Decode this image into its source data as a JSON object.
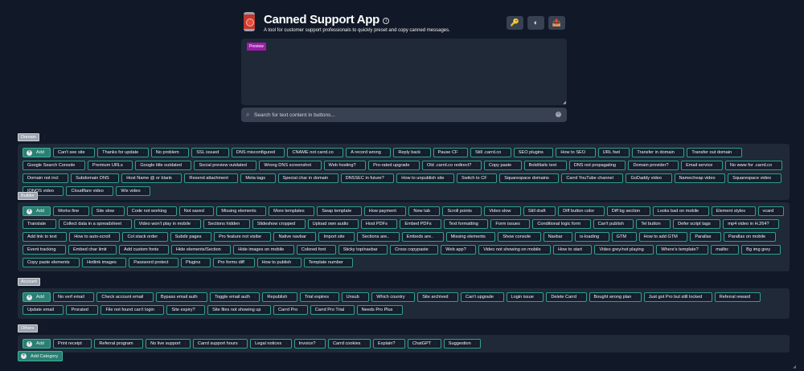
{
  "header": {
    "title": "Canned Support App",
    "info_icon": "i",
    "subtitle": "A tool for customer support professionals to quickly preset and copy canned messages.",
    "buttons": [
      {
        "icon": "key-icon",
        "glyph": "🔑"
      },
      {
        "icon": "theme-toggle-icon",
        "glyph": "◐"
      },
      {
        "icon": "export-icon",
        "glyph": "📤"
      }
    ]
  },
  "preview": {
    "badge": "Preview"
  },
  "search": {
    "placeholder": "Search for text content in buttons...",
    "clear": "×"
  },
  "add_label": "Add",
  "categories": [
    {
      "name": "Domain",
      "items": [
        "Can't see site",
        "Thanks for update",
        "No problem",
        "SSL issued",
        "DNS misconfigured",
        "CNAME not carrd.co",
        "A record wrong",
        "Reply back",
        "Pause CF",
        "Still .carrd.co",
        "SEO plugins",
        "How to SEO",
        "URL fwd",
        "Transfer in domain",
        "Transfer out domain",
        "Google Search Console",
        "Premium URLs",
        "Google title outdated",
        "Social preview outdated",
        "Wrong DNS screenshot",
        "Web hosting?",
        "Pro-rated upgrade",
        "Old .carrd.co redirect?",
        "Copy paste",
        "Bold/italic text",
        "DNS not propagating",
        "Domain provider?",
        "Email service",
        "No www for .carrd.co",
        "Domain not incl",
        "Subdomain DNS",
        "Host Name @ or blank",
        "Resend attachment",
        "Meta tags",
        "Special char in domain",
        "DNSSEC in future?",
        "How to unpublish site",
        "Switch to CF",
        "Squarespace domains",
        "Carrd YouTube channel",
        "GoDaddy video",
        "Namecheap video",
        "Squarespace video",
        "IONOS video",
        "Cloudflare video",
        "Wix video"
      ]
    },
    {
      "name": "Builder",
      "items": [
        "Works fine",
        "Site slow",
        "Code not working",
        "Not saved",
        "Missing elements",
        "More templates",
        "Swap template",
        "How payment",
        "New tab",
        "Scroll points",
        "Video slow",
        "Still draft",
        "Diff button color",
        "Diff bg section",
        "Looks bad on mobile",
        "Element styles",
        "vcard",
        "Translate",
        "Collect data in a spreadsheet",
        "Video won't play in mobile",
        "Sections hidden",
        "Slideshow cropped",
        "Upload own audio",
        "Host PDFs",
        "Embed PDFs",
        "Text formatting",
        "Form issues",
        "Conditional logic form",
        "Can't publish",
        "Tel button",
        "Defer script tags",
        "mp4 video in H.264?",
        "Add link to text",
        "How to auto-scroll",
        "Col stack order",
        "Subdir pages",
        "Pro feature not visibe",
        "Native navbar",
        "Import site",
        "Sections are..",
        "Embeds are..",
        "Missing elements",
        "Show console",
        "Navbar",
        "is-loading",
        "GTM",
        "How to add GTM",
        "Parallax",
        "Parallax on mobile",
        "Event tracking",
        "Embed char limit",
        "Add custom fonts",
        "Hide elements/Section",
        "Hide images on mobile",
        "Colored font",
        "Sticky top/navbar",
        "Cross copypaste",
        "Web app?",
        "Video not showing on mobile",
        "How to start",
        "Video grey/not playing",
        "Where's template?",
        "mailto:",
        "Bg img grey",
        "Copy paste elements",
        "Hotlink images",
        "Password protect",
        "Plugins",
        "Pro forms diff",
        "How to publish",
        "Template number"
      ]
    },
    {
      "name": "Account",
      "items": [
        "No verf email",
        "Check account email",
        "Bypass email auth",
        "Toggle email auth",
        "Republish",
        "Trial expires",
        "Unsub",
        "Which country",
        "Site archived",
        "Can't upgrade",
        "Login issue",
        "Delete Carrd",
        "Bought wrong plan",
        "Just got Pro but still locked",
        "Referral reward",
        "Update email",
        "Prorated",
        "File not found can't login",
        "Site expiry?",
        "Site files not showing up",
        "Carrd Pro",
        "Carrd Pro Trial",
        "Needs Pro Plus"
      ]
    },
    {
      "name": "Others",
      "items": [
        "Print receipt",
        "Referral program",
        "No live support",
        "Carrd support hours",
        "Legal notices",
        "Invoice?",
        "Carrd cookies",
        "Explain?",
        "ChatGPT",
        "Suggestion"
      ]
    }
  ],
  "add_category": "Add Category",
  "colors": {
    "accent": "#2a7f72",
    "border": "#2f9f8f",
    "bg": "#111827",
    "panel": "#1f2937",
    "badge": "#9b1ea4"
  }
}
